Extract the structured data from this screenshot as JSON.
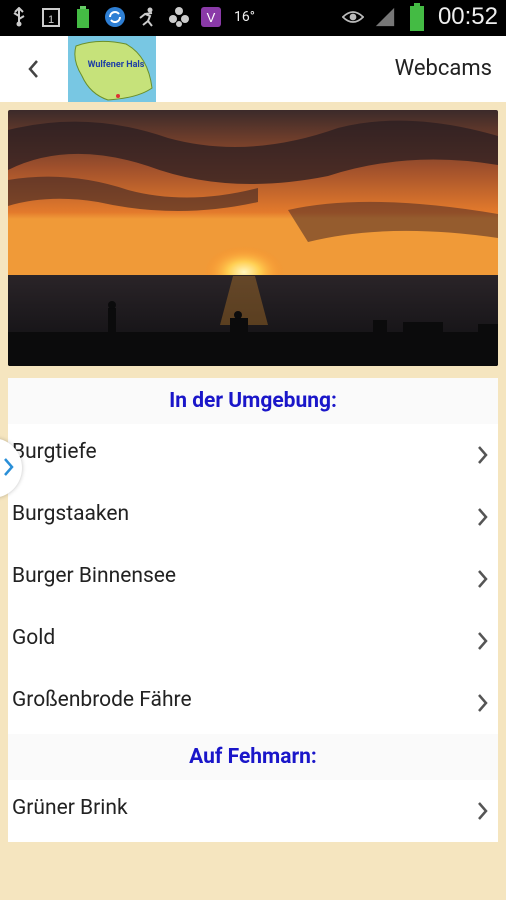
{
  "status_bar": {
    "temperature": "16°",
    "time": "00:52"
  },
  "action_bar": {
    "logo_text": "Wulfener Hals",
    "title": "Webcams"
  },
  "sections": [
    {
      "header": "In der Umgebung:",
      "items": [
        {
          "label": "Burgtiefe"
        },
        {
          "label": "Burgstaaken"
        },
        {
          "label": "Burger Binnensee"
        },
        {
          "label": "Gold"
        },
        {
          "label": "Großenbrode Fähre"
        }
      ]
    },
    {
      "header": "Auf Fehmarn:",
      "items": [
        {
          "label": "Grüner Brink"
        }
      ]
    }
  ],
  "colors": {
    "page_background": "#f5e5bf",
    "section_header": "#1a16c9",
    "logo_background": "#78c7e3"
  }
}
